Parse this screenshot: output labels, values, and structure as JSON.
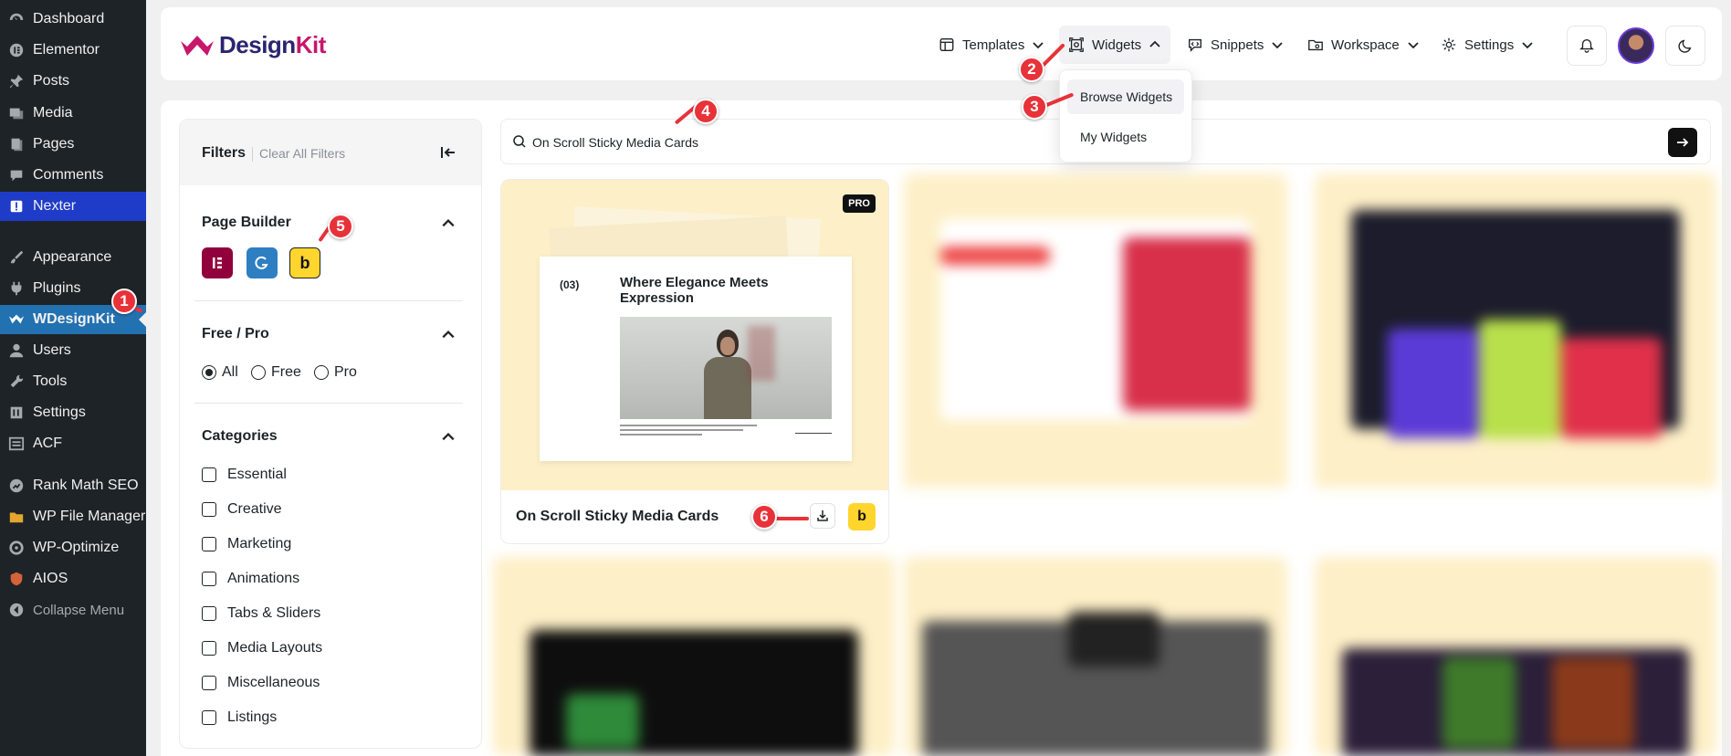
{
  "wp_menu": [
    {
      "label": "Dashboard",
      "icon": "dashboard-icon"
    },
    {
      "label": "Elementor",
      "icon": "elementor-icon"
    },
    {
      "label": "Posts",
      "icon": "pin-icon"
    },
    {
      "label": "Media",
      "icon": "media-icon"
    },
    {
      "label": "Pages",
      "icon": "pages-icon"
    },
    {
      "label": "Comments",
      "icon": "comments-icon"
    },
    {
      "label": "Nexter",
      "icon": "nexter-icon"
    },
    {
      "label": "Appearance",
      "icon": "brush-icon"
    },
    {
      "label": "Plugins",
      "icon": "plug-icon"
    },
    {
      "label": "WDesignKit",
      "icon": "wdesignkit-icon"
    },
    {
      "label": "Users",
      "icon": "users-icon"
    },
    {
      "label": "Tools",
      "icon": "wrench-icon"
    },
    {
      "label": "Settings",
      "icon": "settings-icon"
    },
    {
      "label": "ACF",
      "icon": "acf-icon"
    },
    {
      "label": "Rank Math SEO",
      "icon": "rankmath-icon"
    },
    {
      "label": "WP File Manager",
      "icon": "folder-icon"
    },
    {
      "label": "WP-Optimize",
      "icon": "optimize-icon"
    },
    {
      "label": "AIOS",
      "icon": "shield-icon"
    },
    {
      "label": "Collapse Menu",
      "icon": "collapse-icon"
    }
  ],
  "header": {
    "logo_main": "Design",
    "logo_accent": "Kit",
    "nav": {
      "templates": "Templates",
      "widgets": "Widgets",
      "snippets": "Snippets",
      "workspace": "Workspace",
      "settings": "Settings"
    }
  },
  "widgets_dropdown": {
    "browse": "Browse Widgets",
    "mine": "My Widgets"
  },
  "filters": {
    "title": "Filters",
    "clear": "Clear All Filters",
    "page_builder": {
      "title": "Page Builder",
      "builders": [
        "elementor",
        "gutenberg",
        "bricks"
      ]
    },
    "free_pro": {
      "title": "Free / Pro",
      "options": [
        "All",
        "Free",
        "Pro"
      ],
      "selected": "All"
    },
    "categories": {
      "title": "Categories",
      "items": [
        "Essential",
        "Creative",
        "Marketing",
        "Animations",
        "Tabs & Sliders",
        "Media Layouts",
        "Miscellaneous",
        "Listings"
      ]
    }
  },
  "search": {
    "value": "On Scroll Sticky Media Cards"
  },
  "card": {
    "badge": "PRO",
    "preview_num": "(03)",
    "preview_title": "Where Elegance Meets Expression",
    "title": "On Scroll Sticky Media Cards",
    "builder_badge": "b"
  },
  "markers": [
    "1",
    "2",
    "3",
    "4",
    "5",
    "6"
  ],
  "colors": {
    "wp_sidebar": "#1d2327",
    "wp_active": "#2271b1",
    "nexter": "#1f3cc8",
    "brand_dark": "#2b2470",
    "brand_pink": "#c8166a",
    "card_bg": "#fdefc7",
    "bricks_yellow": "#ffd52e",
    "elementor": "#92003b",
    "gutenberg": "#2e7fc2",
    "marker_red": "#e8323a"
  }
}
